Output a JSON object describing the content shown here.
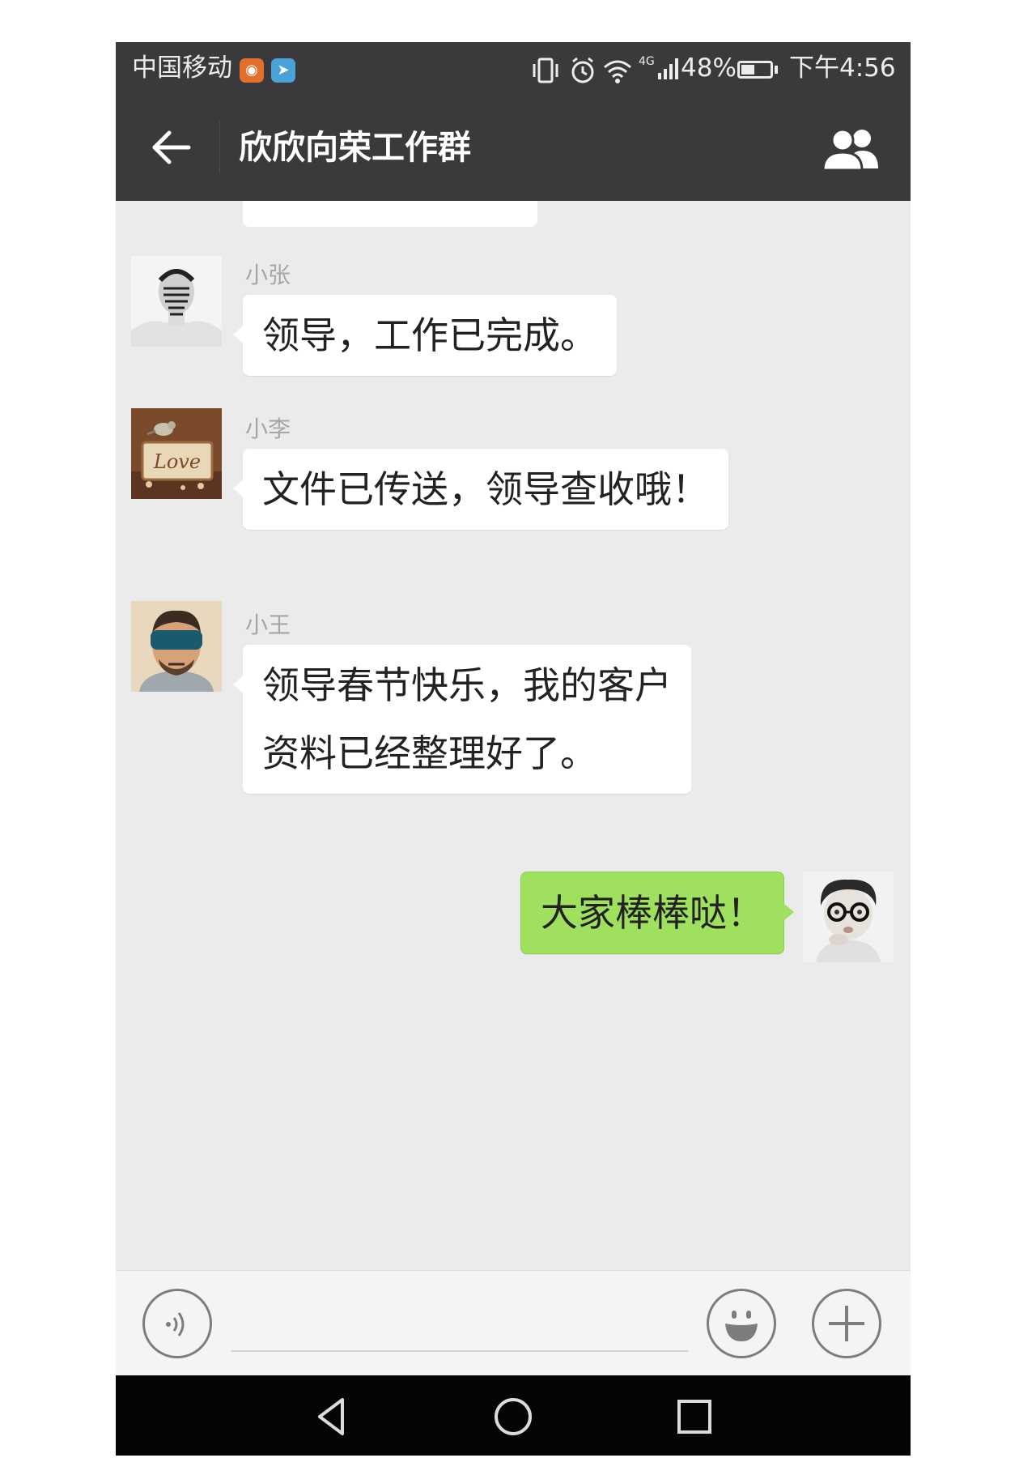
{
  "status_bar": {
    "carrier": "中国移动",
    "app_icons": [
      "weibo-icon",
      "telegram-icon"
    ],
    "status_icons": [
      "vibrate-icon",
      "alarm-icon",
      "wifi-icon",
      "4g-icon",
      "signal-icon",
      "battery-icon"
    ],
    "network": "4G",
    "battery_percent": "48%",
    "battery_level": 0.48,
    "time": "下午4:56"
  },
  "header": {
    "back_icon": "back-arrow-icon",
    "title": "欣欣向荣工作群",
    "members_icon": "group-members-icon"
  },
  "messages": [
    {
      "sender": "小张",
      "text": "领导，工作已完成。",
      "outgoing": false
    },
    {
      "sender": "小李",
      "text": "文件已传送，领导查收哦！",
      "outgoing": false
    },
    {
      "sender": "小王",
      "lines": [
        "领导春节快乐，我的客户",
        "资料已经整理好了。"
      ],
      "outgoing": false
    },
    {
      "sender": "",
      "text": "大家棒棒哒！",
      "outgoing": true
    }
  ],
  "input_bar": {
    "voice_icon": "voice-input-icon",
    "emoji_icon": "emoji-icon",
    "plus_icon": "plus-icon",
    "input_value": ""
  },
  "nav_bar": {
    "icons": [
      "back-triangle-icon",
      "home-circle-icon",
      "recents-square-icon"
    ]
  },
  "colors": {
    "status_bar_bg": "#3a3a3c",
    "chat_bg": "#ebebeb",
    "incoming_bubble": "#ffffff",
    "outgoing_bubble": "#9fe15e",
    "nav_bar_bg": "#050505"
  }
}
